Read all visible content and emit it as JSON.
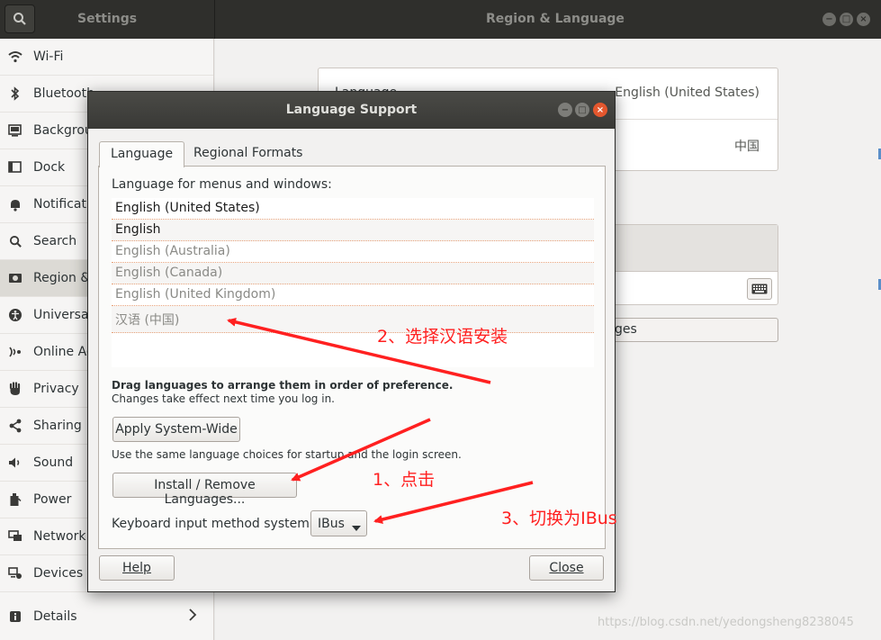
{
  "settings": {
    "app_title": "Settings",
    "panel_title": "Region & Language",
    "sidebar": [
      {
        "label": "Wi-Fi",
        "icon": "wifi-icon"
      },
      {
        "label": "Bluetooth",
        "icon": "bluetooth-icon"
      },
      {
        "label": "Background",
        "icon": "background-icon"
      },
      {
        "label": "Dock",
        "icon": "dock-icon"
      },
      {
        "label": "Notifications",
        "icon": "bell-icon"
      },
      {
        "label": "Search",
        "icon": "search-icon"
      },
      {
        "label": "Region & Language",
        "icon": "region-icon",
        "selected": true
      },
      {
        "label": "Universal Access",
        "icon": "accessibility-icon"
      },
      {
        "label": "Online Accounts",
        "icon": "online-accounts-icon"
      },
      {
        "label": "Privacy",
        "icon": "hand-icon"
      },
      {
        "label": "Sharing",
        "icon": "share-icon"
      },
      {
        "label": "Sound",
        "icon": "speaker-icon"
      },
      {
        "label": "Power",
        "icon": "power-icon"
      },
      {
        "label": "Network",
        "icon": "network-icon"
      },
      {
        "label": "Devices",
        "icon": "devices-icon"
      },
      {
        "label": "Details",
        "icon": "info-icon"
      }
    ],
    "language_key": "Language",
    "language_value": "English (United States)",
    "formats_value": "中国",
    "manage_label": "Manage Installed Languages"
  },
  "dialog": {
    "title": "Language Support",
    "tabs": [
      "Language",
      "Regional Formats"
    ],
    "menus_label": "Language for menus and windows:",
    "languages": [
      {
        "name": "English (United States)",
        "enabled": true
      },
      {
        "name": "English",
        "enabled": true
      },
      {
        "name": "English (Australia)",
        "enabled": false
      },
      {
        "name": "English (Canada)",
        "enabled": false
      },
      {
        "name": "English (United Kingdom)",
        "enabled": false
      },
      {
        "name": "汉语 (中国)",
        "enabled": false
      }
    ],
    "drag_note": "Drag languages to arrange them in order of preference.",
    "effect_note": "Changes take effect next time you log in.",
    "apply_button": "Apply System-Wide",
    "same_note": "Use the same language choices for startup and the login screen.",
    "install_button": "Install / Remove Languages...",
    "keyboard_label": "Keyboard input method system:",
    "keyboard_value": "IBus",
    "help_button": "Help",
    "close_button": "Close"
  },
  "annotations": {
    "step1": "1、点击",
    "step2": "2、选择汉语安装",
    "step3": "3、切换为IBus",
    "color": "#ff2020"
  },
  "watermark": "https://blog.csdn.net/yedongsheng8238045"
}
